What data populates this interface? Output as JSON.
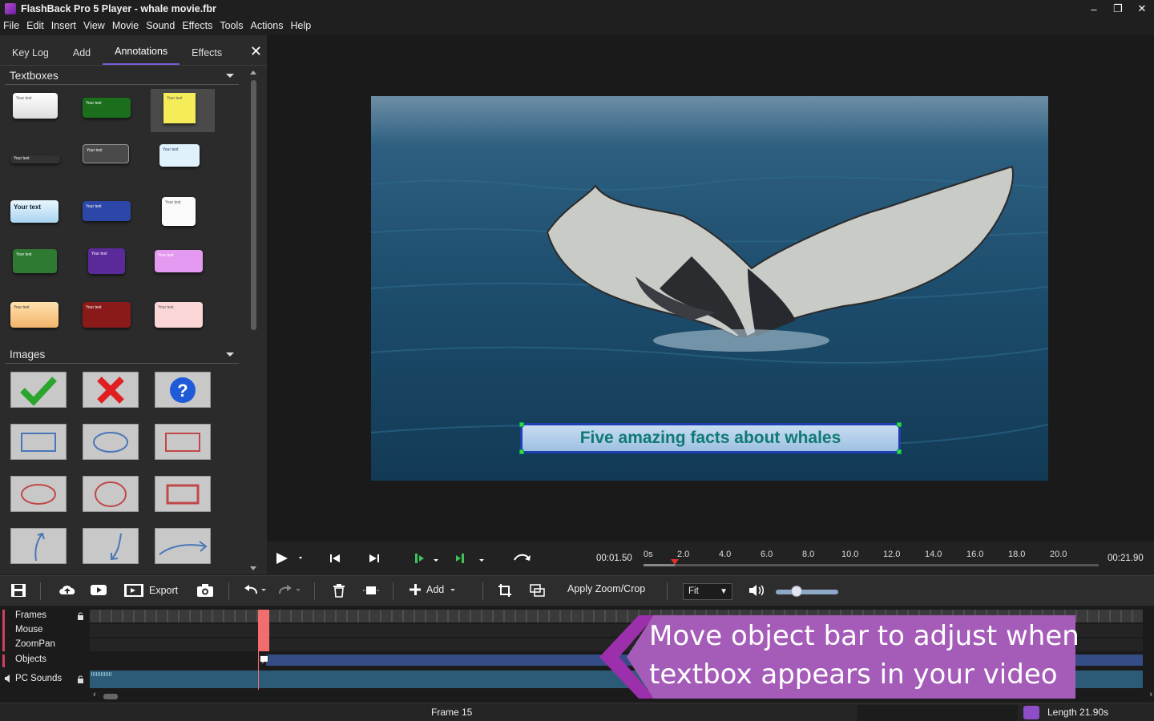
{
  "app": {
    "title": "FlashBack Pro 5 Player - whale movie.fbr"
  },
  "window_controls": {
    "minimize": "–",
    "restore": "❐",
    "close": "✕"
  },
  "menu": [
    "File",
    "Edit",
    "Insert",
    "View",
    "Movie",
    "Sound",
    "Effects",
    "Tools",
    "Actions",
    "Help"
  ],
  "tabs": [
    "Key Log",
    "Add",
    "Annotations",
    "Effects"
  ],
  "active_tab": "Annotations",
  "sections": {
    "textboxes": "Textboxes",
    "images": "Images"
  },
  "textbox_label": "Your text",
  "video": {
    "caption": "Five amazing facts about whales"
  },
  "transport": {
    "current_time": "00:01.50",
    "total_time": "00:21.90",
    "ruler_labels": [
      "0s",
      "2.0",
      "4.0",
      "6.0",
      "8.0",
      "10.0",
      "12.0",
      "14.0",
      "16.0",
      "18.0",
      "20.0"
    ],
    "progress_fraction": 0.068
  },
  "toolbar": {
    "export": "Export",
    "add": "Add",
    "apply_zoom": "Apply Zoom/Crop",
    "fit": "Fit",
    "volume_fraction": 0.33
  },
  "timeline": {
    "tracks": [
      "Frames",
      "Mouse",
      "ZoomPan",
      "Objects",
      "PC Sounds"
    ]
  },
  "callout": {
    "line1": "Move object bar to adjust when",
    "line2": "textbox appears in your video"
  },
  "status": {
    "frame": "Frame 15",
    "length": "Length 21.90s"
  },
  "colors": {
    "accent": "#7b5bd8",
    "callout": "#a55cb8",
    "caption_text": "#0f7a72",
    "caption_border": "#1d3fb0",
    "playhead": "#e03030"
  }
}
